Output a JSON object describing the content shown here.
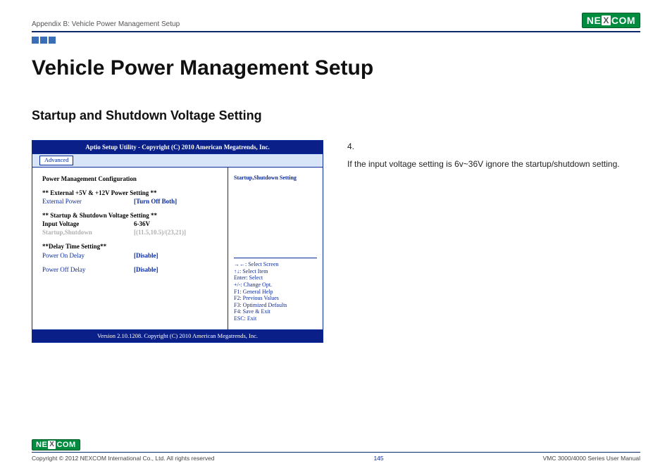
{
  "header": {
    "breadcrumb": "Appendix B: Vehicle Power Management Setup",
    "logo_text_left": "NE",
    "logo_text_x": "X",
    "logo_text_right": "COM"
  },
  "title": "Vehicle Power Management Setup",
  "subtitle": "Startup and Shutdown Voltage Setting",
  "bios": {
    "title": "Aptio Setup Utility - Copyright (C) 2010 American Megatrends, Inc.",
    "tab": "Advanced",
    "section_header": "Power Management Configuration",
    "group1_header": "** External +5V & +12V Power Setting **",
    "row_ext_power_k": "External Power",
    "row_ext_power_v": "[Turn Off Both]",
    "group2_header": "** Startup & Shutdown Voltage Setting **",
    "row_input_voltage_k": "Input Voltage",
    "row_input_voltage_v": "6-36V",
    "row_startup_k": "Startup,Shutdown",
    "row_startup_v": "[(11.5,10.5)/(23,21)]",
    "group3_header": "**Delay Time Setting**",
    "row_on_delay_k": "Power On Delay",
    "row_on_delay_v": "[Disable]",
    "row_off_delay_k": "Power Off Delay",
    "row_off_delay_v": "[Disable]",
    "right_hint": "Startup,Shutdown Setting",
    "help": {
      "l1": "→←: Select Screen",
      "l2": "↑↓: Select Item",
      "l3": "Enter: Select",
      "l4": "+/-: Change Opt.",
      "l5": "F1: General Help",
      "l6": "F2: Previous Values",
      "l7": "F3: Optimized Defaults",
      "l8": "F4: Save & Exit",
      "l9": "ESC: Exit"
    },
    "footer": "Version 2.10.1208. Copyright (C) 2010 American Megatrends, Inc."
  },
  "body_text": {
    "num": "4.",
    "line": "If the input voltage setting is 6v~36V ignore the startup/shutdown setting."
  },
  "footer": {
    "copyright": "Copyright © 2012 NEXCOM International Co., Ltd. All rights reserved",
    "page_num": "145",
    "manual": "VMC 3000/4000 Series User Manual"
  }
}
